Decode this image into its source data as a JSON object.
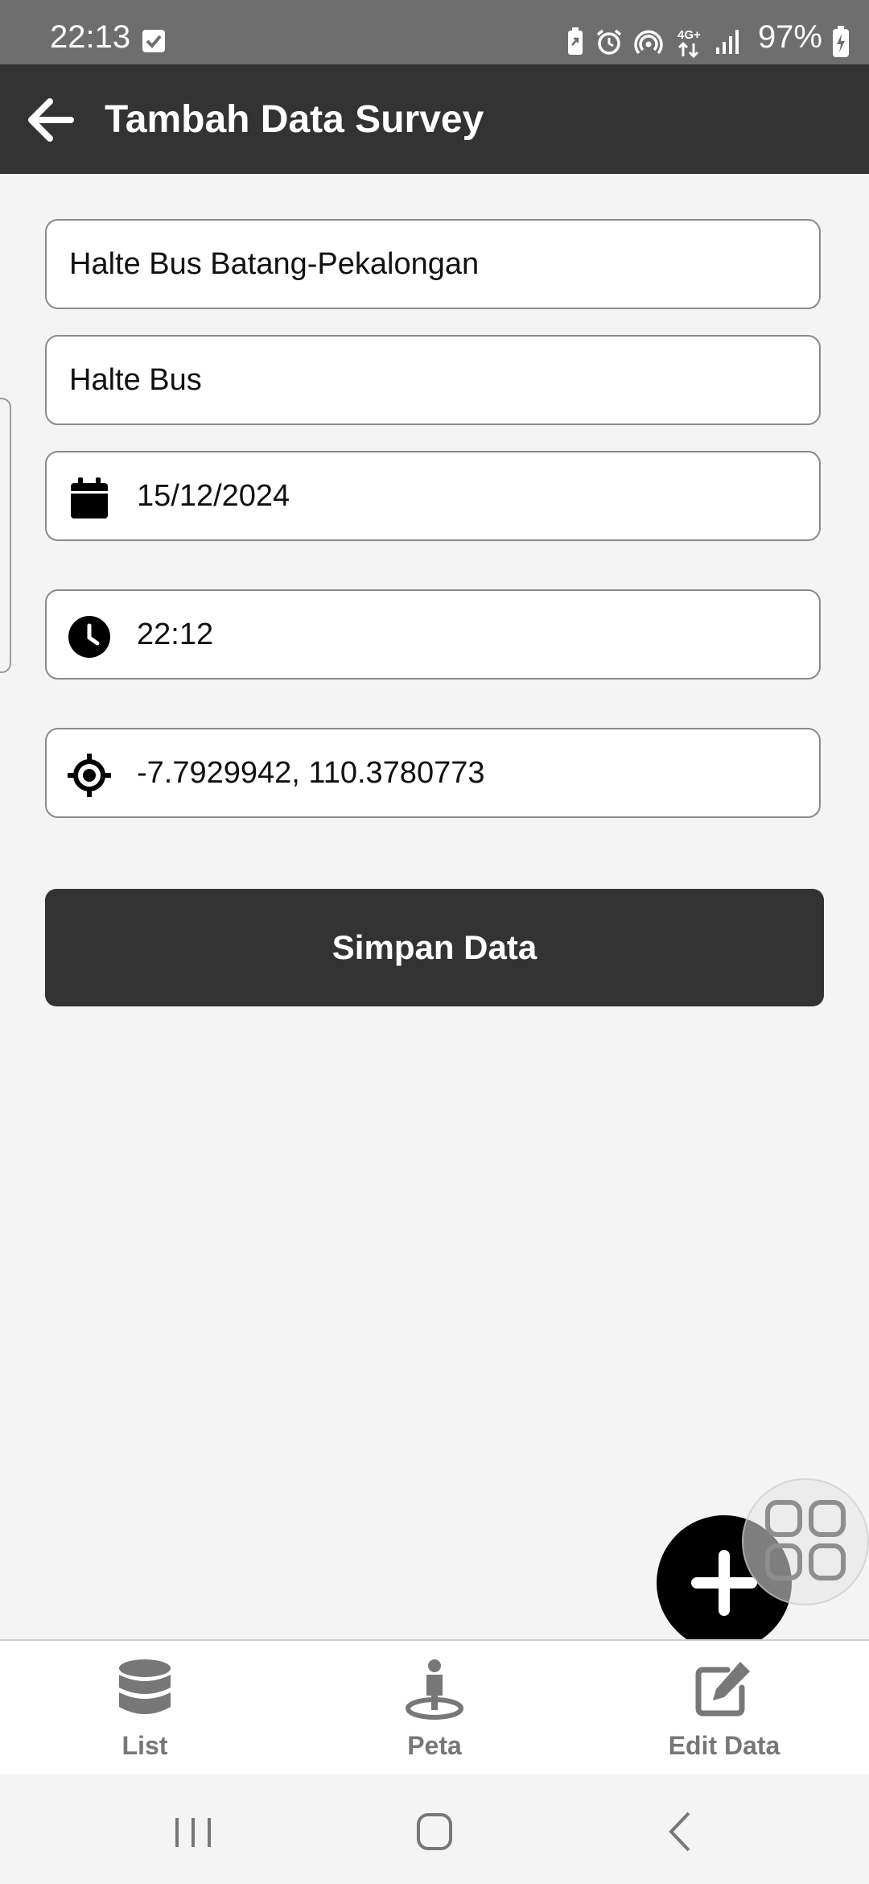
{
  "status_bar": {
    "time": "22:13",
    "battery": "97%",
    "network": "4G+",
    "icons": [
      "checkbox-icon",
      "battery-saver-icon",
      "alarm-icon",
      "hotspot-icon",
      "network-4g-icon",
      "signal-icon",
      "battery-charging-icon"
    ]
  },
  "app_bar": {
    "title": "Tambah Data Survey",
    "back_icon": "arrow-left-icon"
  },
  "form": {
    "name_value": "Halte Bus Batang-Pekalongan",
    "category_value": "Halte Bus",
    "date_value": "15/12/2024",
    "time_value": "22:12",
    "location_value": "-7.7929942, 110.3780773",
    "date_icon": "calendar-icon",
    "time_icon": "clock-icon",
    "location_icon": "crosshair-icon"
  },
  "save_button": {
    "label": "Simpan Data"
  },
  "fab": {
    "icon": "plus-icon"
  },
  "bottom_nav": {
    "items": [
      {
        "label": "List",
        "icon": "database-icon"
      },
      {
        "label": "Peta",
        "icon": "person-location-icon"
      },
      {
        "label": "Edit Data",
        "icon": "edit-icon"
      }
    ]
  },
  "colors": {
    "app_bar": "#333333",
    "status_bar": "#6e6e6e",
    "background": "#f4f4f5",
    "nav_inactive": "#777777",
    "fab": "#000000"
  }
}
